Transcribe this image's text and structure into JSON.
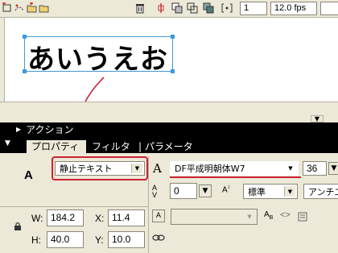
{
  "timeline": {
    "frame_value": "1",
    "fps_value": "12.0 fps"
  },
  "stage": {
    "text": "あいうえお"
  },
  "panels": {
    "action_title": "アクション"
  },
  "tabs": {
    "properties": "プロパティ",
    "filter": "フィルタ",
    "separator": "|",
    "parameters": "パラメータ"
  },
  "properties": {
    "text_type_icon": "A",
    "text_type_value": "静止テキスト",
    "font_icon": "A",
    "font_value": "DF平成明朝体W7",
    "font_size": "36",
    "letter_spacing": "0",
    "char_position": "標準",
    "anti_alias": "アンチエ",
    "width_label": "W:",
    "width_value": "184.2",
    "height_label": "H:",
    "height_value": "40.0",
    "x_label": "X:",
    "x_value": "11.4",
    "y_label": "Y:",
    "y_value": "10.0"
  },
  "colors": {
    "panel_bg": "#ece9d8",
    "highlight_red": "#cc2233",
    "selection_blue": "#3e9ad9"
  }
}
